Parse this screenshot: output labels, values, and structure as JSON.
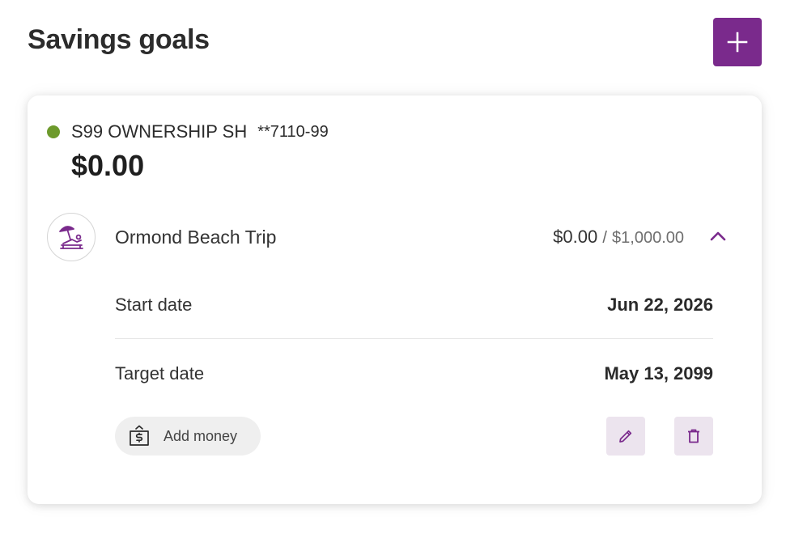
{
  "header": {
    "title": "Savings goals",
    "add_button_icon": "plus-icon"
  },
  "account": {
    "name": "S99 OWNERSHIP SH",
    "masked_number": "**7110-99",
    "balance": "$0.00",
    "status_color": "#6d9a2c"
  },
  "goal": {
    "icon": "beach-lounge-icon",
    "name": "Ormond Beach Trip",
    "saved": "$0.00",
    "separator": "/",
    "target": "$1,000.00",
    "expanded": true,
    "start_date_label": "Start date",
    "start_date": "Jun 22, 2026",
    "target_date_label": "Target date",
    "target_date": "May 13, 2099",
    "add_money_label": "Add money",
    "edit_icon": "pencil-icon",
    "delete_icon": "trash-icon"
  },
  "colors": {
    "accent": "#7a2a8c",
    "action_bg": "#ece4ee"
  }
}
